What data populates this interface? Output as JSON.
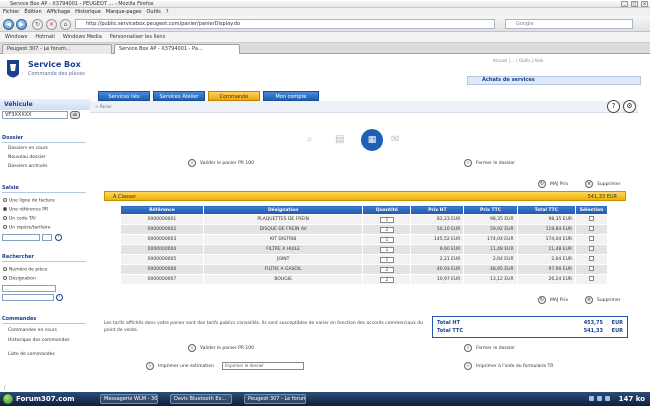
{
  "window": {
    "title": "Service Box AP - X3794001 - PEUGEOT ... - Mozilla Firefox"
  },
  "browser": {
    "menu": [
      "Fichier",
      "Édition",
      "Affichage",
      "Historique",
      "Marque-pages",
      "Outils",
      "?"
    ],
    "url": "http://public.servicebox.peugeot.com/panier/panierDisplay.do",
    "search_placeholder": "Google",
    "bookmarks": [
      "Windows",
      "Hotmail",
      "Windows Media",
      "Personnaliser les liens"
    ],
    "tabs": [
      "Peugeot 307 - Le forum...",
      "Service Box AP - X3794001 - Pa..."
    ]
  },
  "header": {
    "brand": "Service Box",
    "subtitle": "Commande des pièces",
    "top_links": "Accueil | ... | Outils | Aide",
    "achats": "Achats de services"
  },
  "nav": {
    "tabs": [
      "Services liés",
      "Services Atelier",
      "Commande",
      "Mon compte"
    ],
    "breadcrumb": "> Panier"
  },
  "sidebar": {
    "vehicule_label": "Véhicule",
    "vin_value": "VF3XXXXX",
    "go": "ok",
    "dossier_label": "Dossier",
    "dossier_items": [
      "Dossiers en cours",
      "Nouveau dossier",
      "Dossiers archivés"
    ],
    "saisie_label": "Saisie",
    "saisie_items": [
      "Une ligne de facture",
      "Une référence PR",
      "Un code TAI",
      "Un repère/tarifaire"
    ],
    "recherche_label": "Rechercher",
    "recherche_items": [
      "Numéro de pièce",
      "Désignation"
    ],
    "recherche_select": "...",
    "commandes_label": "Commandes",
    "commandes_items": [
      "Commandes en cours",
      "Historique des commandes",
      "Liste de commandes"
    ]
  },
  "main": {
    "valider_link": "Valider le panier PR 100",
    "fermer_link": "Fermer le dossier",
    "maj_prix": "MAJ Prix",
    "supprimer": "Supprimer",
    "panel_title": "À Classer",
    "panel_total": "541,33 EUR",
    "columns": [
      "Référence",
      "Désignation",
      "Quantité",
      "Prix HT",
      "Prix TTC",
      "Total TTC",
      "Sélection"
    ],
    "rows": [
      [
        "0000000001",
        "PLAQUETTES DE FREIN",
        "1",
        "82,23 EUR",
        "98,35 EUR",
        "98,35 EUR"
      ],
      [
        "0000000002",
        "DISQUE DE FREIN AV",
        "2",
        "50,10 EUR",
        "59,92 EUR",
        "119,84 EUR"
      ],
      [
        "0000000003",
        "KIT DISTRIB",
        "1",
        "145,52 EUR",
        "174,04 EUR",
        "174,04 EUR"
      ],
      [
        "0000000004",
        "FILTRE A HUILE",
        "1",
        "9,60 EUR",
        "11,48 EUR",
        "11,48 EUR"
      ],
      [
        "0000000005",
        "JOINT",
        "1",
        "2,21 EUR",
        "2,64 EUR",
        "2,64 EUR"
      ],
      [
        "0000000006",
        "FILTRE A GASOIL",
        "2",
        "40,93 EUR",
        "48,95 EUR",
        "97,90 EUR"
      ],
      [
        "0000000007",
        "BOUGIE",
        "2",
        "10,97 EUR",
        "13,12 EUR",
        "26,24 EUR"
      ]
    ],
    "note": "Les tarifs affichés dans votre panier sont des tarifs publics conseillés. Ils sont susceptibles de varier en fonction des accords commerciaux du point de vente.",
    "total_ht_label": "Total HT",
    "total_ht_value": "453,75",
    "total_ttc_label": "Total TTC",
    "total_ttc_value": "541,33",
    "currency": "EUR",
    "valider_link2": "Valider le panier PR 100",
    "fermer_link2": "Fermer le dossier",
    "imprimer_label": "Imprimer une estimation",
    "imprimer_select": "Imprimer le dossier",
    "imprimer_facture": "Imprimer à l'aide du formulaire TR"
  },
  "taskbar": {
    "forum": "Forum307.com",
    "items": [
      "Messagerie WLM - 307...",
      "Devis Bluetooth Ex...",
      "Peugeot 307 - Le forum"
    ],
    "clock": "147 ko"
  }
}
